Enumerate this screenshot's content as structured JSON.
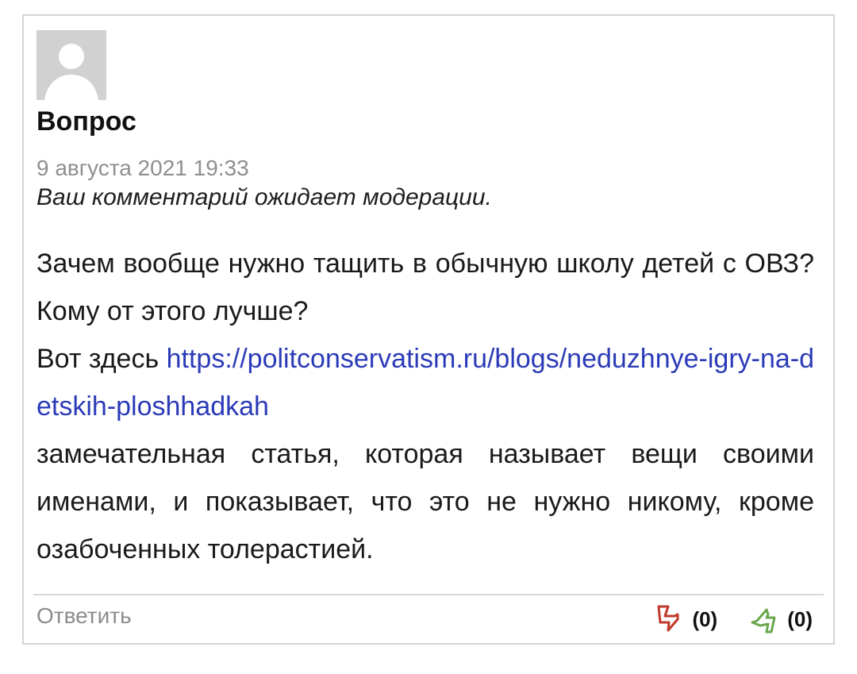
{
  "comment": {
    "author": "Вопрос",
    "date": "9 августа 2021 19:33",
    "moderation_note": "Ваш комментарий ожидает модерации.",
    "body": {
      "paragraph1": "Зачем вообще нужно тащить в обычную школу детей с ОВЗ? Кому от этого лучше?",
      "link_prefix": "Вот здесь ",
      "link_text": "https://politconservatism.ru/blogs/neduzhnye-igry-na-detskih-ploshhadkah",
      "paragraph3": "замечательная статья, которая называет вещи своими именами, и показывает, что это не нужно никому, кроме озабоченных толерастией."
    },
    "reply_label": "Ответить",
    "votes": {
      "dislike_count": "(0)",
      "like_count": "(0)",
      "dislike_icon": "thumbs-down-icon",
      "like_icon": "thumbs-up-icon",
      "dislike_color": "#c0392b",
      "like_color": "#6aa84f"
    },
    "link_color": "#2b3bb8"
  }
}
